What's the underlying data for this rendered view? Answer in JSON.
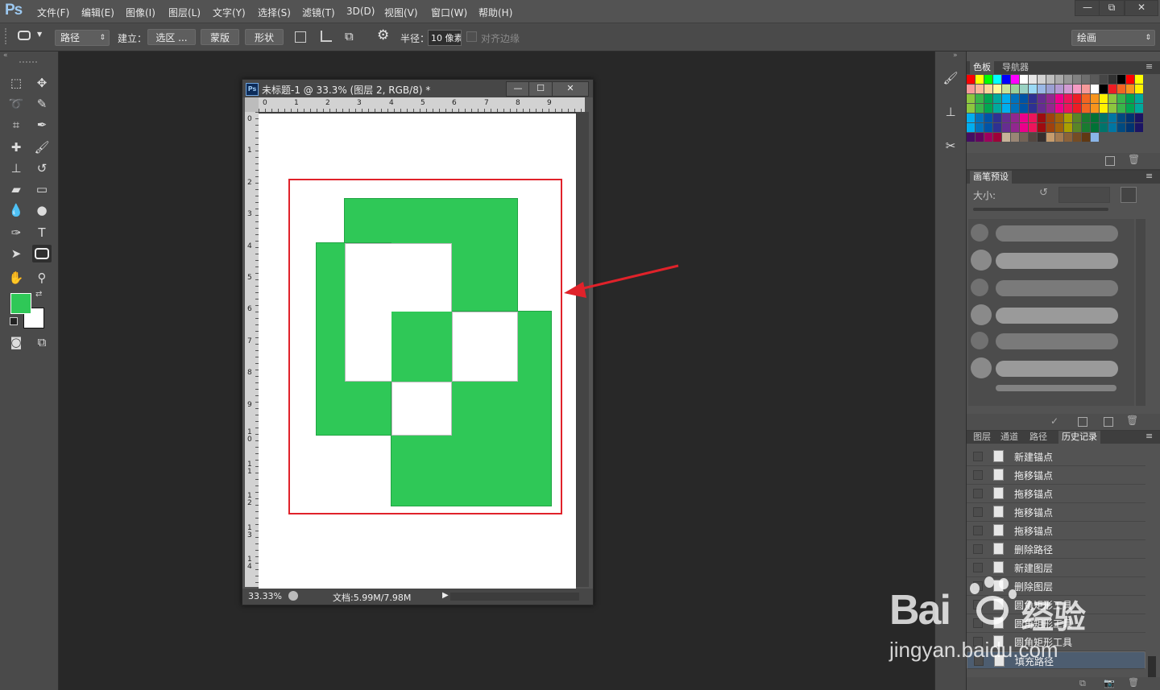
{
  "app": {
    "logo": "Ps"
  },
  "menu": [
    "文件(F)",
    "编辑(E)",
    "图像(I)",
    "图层(L)",
    "文字(Y)",
    "选择(S)",
    "滤镜(T)",
    "3D(D)",
    "视图(V)",
    "窗口(W)",
    "帮助(H)"
  ],
  "window_controls": {
    "minimize": "—",
    "restore": "⧉",
    "close": "✕"
  },
  "options": {
    "mode": "路径",
    "build_label": "建立：",
    "selection_btn": "选区 ...",
    "mask_btn": "蒙版",
    "shape_btn": "形状",
    "radius_label": "半径：",
    "radius_value": "10 像素",
    "align_edges": "对齐边缘",
    "workspace": "绘画"
  },
  "document": {
    "title": "未标题-1 @ 33.3% (图层 2, RGB/8) *",
    "ps_badge": "Ps",
    "zoom": "33.33%",
    "doc_info": "文档:5.99M/7.98M",
    "ruler_top": [
      "0",
      "1",
      "2",
      "3",
      "4",
      "5",
      "6",
      "7",
      "8",
      "9"
    ],
    "ruler_left": [
      "0",
      "1",
      "2",
      "3",
      "4",
      "5",
      "6",
      "7",
      "8",
      "9",
      "1\n0",
      "1\n1",
      "1\n2",
      "1\n3",
      "1\n4"
    ]
  },
  "colors": {
    "foreground": "#2fc857",
    "background": "#ffffff",
    "shape_fill": "#2fc857",
    "highlight_box": "#e0222a",
    "arrow": "#e0222a"
  },
  "panels": {
    "swatches_tabs": [
      "色板",
      "导航器"
    ],
    "brush_tabs": [
      "画笔预设"
    ],
    "brush_size_label": "大小:",
    "history_tabs": [
      "图层",
      "通道",
      "路径",
      "历史记录"
    ],
    "history_items": [
      "新建锚点",
      "拖移锚点",
      "拖移锚点",
      "拖移锚点",
      "拖移锚点",
      "删除路径",
      "新建图层",
      "删除图层",
      "圆角矩形工具",
      "圆角矩形工具",
      "圆角矩形工具",
      "填充路径"
    ]
  },
  "watermark": {
    "brand": "Bai",
    "brand2": "经验",
    "url": "jingyan.baidu.com"
  }
}
